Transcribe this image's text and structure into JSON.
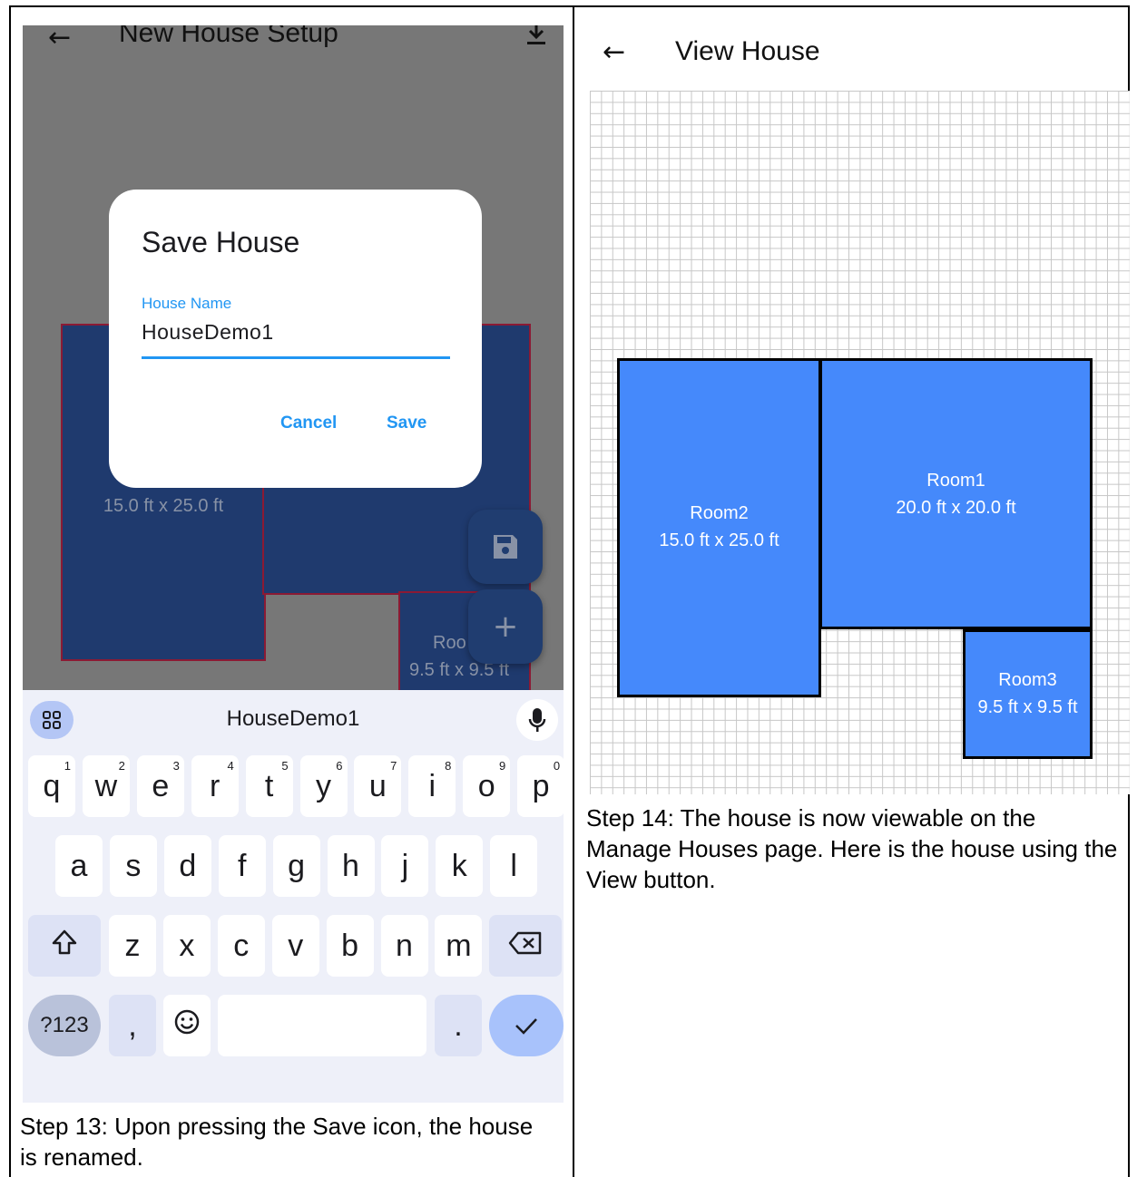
{
  "left": {
    "app_title": "New House Setup",
    "rooms": [
      {
        "dims": "15.0 ft x 25.0 ft"
      },
      {
        "name": "Roo",
        "dims": "9.5 ft x 9.5 ft"
      }
    ],
    "dialog": {
      "title": "Save House",
      "field_label": "House Name",
      "field_value": "HouseDemo1",
      "cancel": "Cancel",
      "save": "Save"
    },
    "keyboard": {
      "suggestion": "HouseDemo1",
      "row1": [
        {
          "k": "q",
          "h": "1"
        },
        {
          "k": "w",
          "h": "2"
        },
        {
          "k": "e",
          "h": "3"
        },
        {
          "k": "r",
          "h": "4"
        },
        {
          "k": "t",
          "h": "5"
        },
        {
          "k": "y",
          "h": "6"
        },
        {
          "k": "u",
          "h": "7"
        },
        {
          "k": "i",
          "h": "8"
        },
        {
          "k": "o",
          "h": "9"
        },
        {
          "k": "p",
          "h": "0"
        }
      ],
      "row2": [
        "a",
        "s",
        "d",
        "f",
        "g",
        "h",
        "j",
        "k",
        "l"
      ],
      "row3": [
        "z",
        "x",
        "c",
        "v",
        "b",
        "n",
        "m"
      ],
      "symbols": "?123",
      "comma": ",",
      "period": "."
    },
    "caption": "Step 13: Upon pressing the Save icon, the house is renamed."
  },
  "right": {
    "app_title": "View House",
    "rooms": [
      {
        "name": "Room2",
        "dims": "15.0 ft x 25.0 ft"
      },
      {
        "name": "Room1",
        "dims": "20.0 ft x 20.0 ft"
      },
      {
        "name": "Room3",
        "dims": "9.5 ft x 9.5 ft"
      }
    ],
    "caption": "Step 14: The house is now viewable on the Manage Houses page. Here is the house using the View button."
  },
  "colors": {
    "accent": "#2196f3",
    "room_blue": "#4589fb",
    "room_dark": "#1f3a6e",
    "room_border_dark": "#8b1a34",
    "scrim": "#777777"
  },
  "icons": [
    "back-arrow-icon",
    "download-icon",
    "save-icon",
    "plus-icon",
    "apps-grid-icon",
    "microphone-icon",
    "shift-icon",
    "backspace-icon",
    "emoji-icon",
    "check-icon"
  ]
}
